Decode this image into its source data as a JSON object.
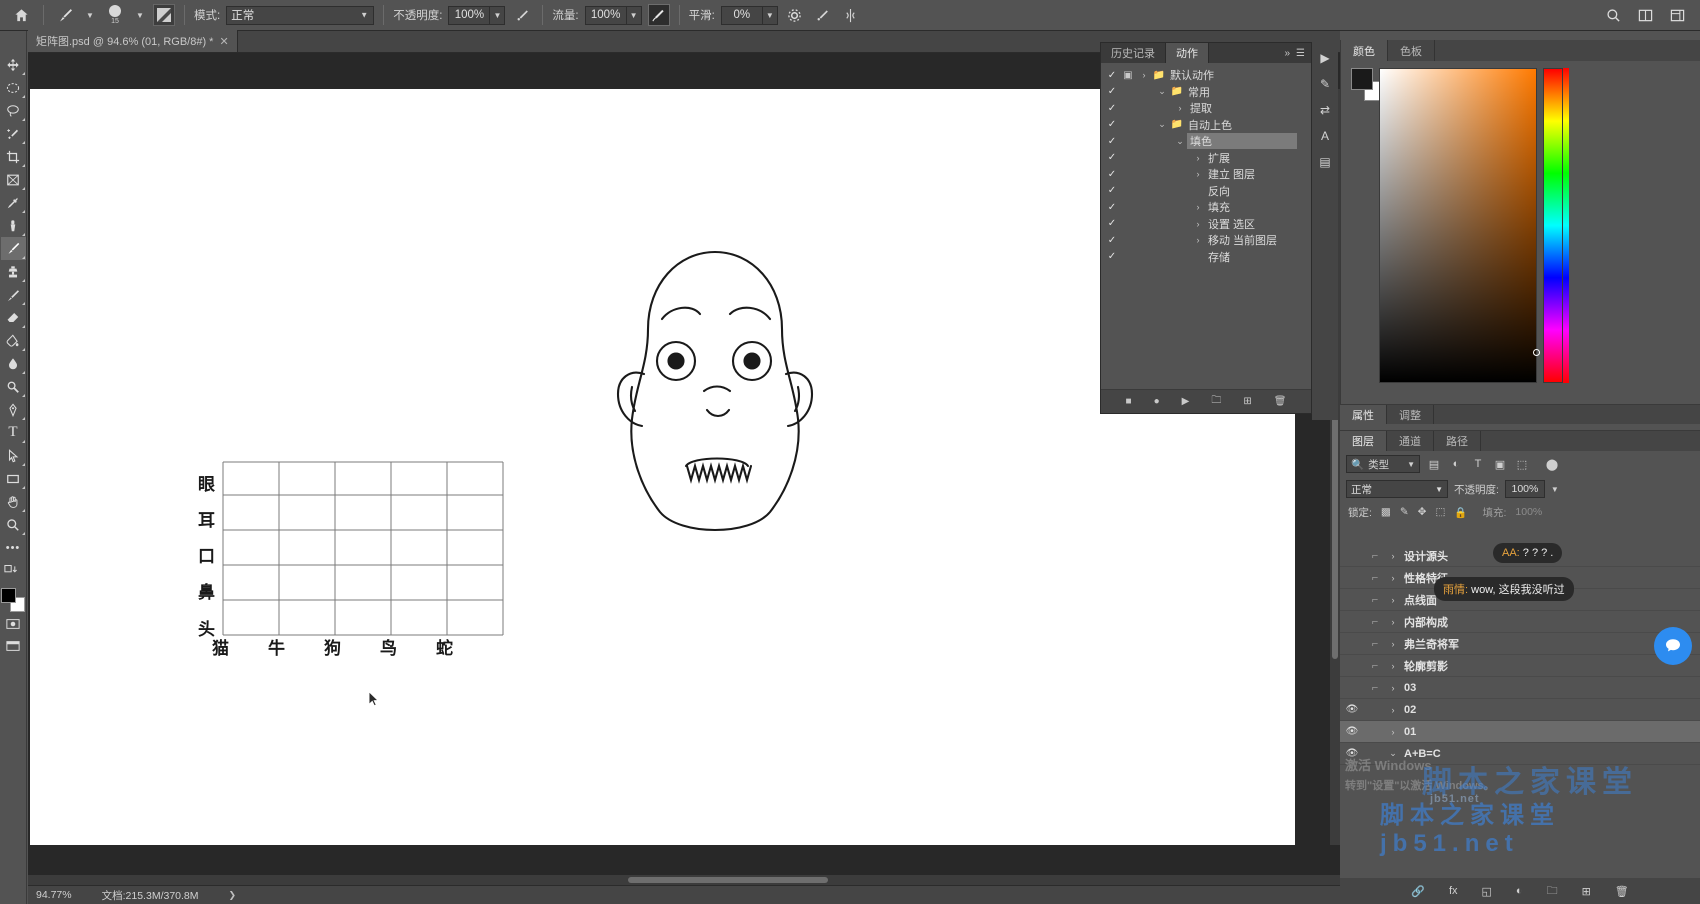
{
  "options_bar": {
    "home_icon": "home-icon",
    "brush_tool_icon": "brush-icon",
    "brush_size": "15",
    "brush_panel_icon": "brush-panel-icon",
    "mode_label": "模式:",
    "mode_value": "正常",
    "opacity_label": "不透明度:",
    "opacity_value": "100%",
    "pressure_opacity_icon": "pressure-opacity-icon",
    "flow_label": "流量:",
    "flow_value": "100%",
    "airbrush_icon": "airbrush-icon",
    "smoothing_label": "平滑:",
    "smoothing_value": "0%",
    "gear_icon": "gear-icon",
    "pressure_size_icon": "pressure-size-icon",
    "symmetry_icon": "symmetry-icon",
    "search_icon": "search-icon",
    "arrange_icon": "arrange-documents-icon",
    "workspace_icon": "workspace-switcher-icon"
  },
  "document_tab": {
    "title": "矩阵图.psd @ 94.6% (01, RGB/8#) *",
    "close_icon": "close-icon"
  },
  "toolbar": {
    "tools": [
      {
        "name": "move-tool",
        "icon": "✥"
      },
      {
        "name": "elliptical-marquee-tool",
        "icon": "◯"
      },
      {
        "name": "lasso-tool",
        "icon": "◝"
      },
      {
        "name": "quick-selection-tool",
        "icon": "✧"
      },
      {
        "name": "crop-tool",
        "icon": "⌗"
      },
      {
        "name": "frame-tool",
        "icon": "⊠"
      },
      {
        "name": "eyedropper-tool",
        "icon": "⚲"
      },
      {
        "name": "healing-brush-tool",
        "icon": "✎"
      },
      {
        "name": "brush-tool",
        "icon": "✏",
        "selected": true
      },
      {
        "name": "clone-stamp-tool",
        "icon": "⚑"
      },
      {
        "name": "history-brush-tool",
        "icon": "✒"
      },
      {
        "name": "eraser-tool",
        "icon": "◓"
      },
      {
        "name": "gradient-tool",
        "icon": "◧"
      },
      {
        "name": "blur-tool",
        "icon": "💧"
      },
      {
        "name": "dodge-tool",
        "icon": "◉"
      },
      {
        "name": "pen-tool",
        "icon": "✒"
      },
      {
        "name": "type-tool",
        "icon": "T"
      },
      {
        "name": "path-selection-tool",
        "icon": "➤"
      },
      {
        "name": "rectangle-tool",
        "icon": "▭"
      },
      {
        "name": "hand-tool",
        "icon": "✋"
      },
      {
        "name": "zoom-tool",
        "icon": "🔍"
      },
      {
        "name": "more-tools",
        "icon": "•••"
      }
    ],
    "edit_toolbar_icon": "edit-toolbar-icon",
    "foreground_color": "#000000",
    "background_color": "#ffffff",
    "quick_mask_icon": "quick-mask-icon",
    "screen_mode_icon": "screen-mode-icon"
  },
  "canvas": {
    "matrix": {
      "row_labels": [
        "眼",
        "耳",
        "口",
        "鼻",
        "头"
      ],
      "col_labels": [
        "猫",
        "牛",
        "狗",
        "鸟",
        "蛇"
      ],
      "rows": 5,
      "cols": 5
    },
    "artwork_name": "face-line-drawing",
    "cursor_name": "mouse-cursor"
  },
  "actions_panel": {
    "tabs": [
      {
        "label": "历史记录",
        "active": false
      },
      {
        "label": "动作",
        "active": true
      }
    ],
    "collapse_icon": "collapse-icon",
    "menu_icon": "panel-menu-icon",
    "items": [
      {
        "label": "默认动作",
        "checked": true,
        "type": "folder",
        "indent": 0,
        "expand": "›",
        "has_box": true
      },
      {
        "label": "常用",
        "checked": true,
        "type": "folder",
        "indent": 1,
        "expand": "⌄"
      },
      {
        "label": "提取",
        "checked": true,
        "type": "action",
        "indent": 2,
        "expand": "›"
      },
      {
        "label": "自动上色",
        "checked": true,
        "type": "folder",
        "indent": 1,
        "expand": "⌄"
      },
      {
        "label": "填色",
        "checked": true,
        "type": "action",
        "indent": 2,
        "expand": "⌄",
        "selected": true
      },
      {
        "label": "扩展",
        "checked": true,
        "type": "step",
        "indent": 3,
        "expand": "›"
      },
      {
        "label": "建立 图层",
        "checked": true,
        "type": "step",
        "indent": 3,
        "expand": "›"
      },
      {
        "label": "反向",
        "checked": true,
        "type": "step",
        "indent": 3,
        "expand": ""
      },
      {
        "label": "填充",
        "checked": true,
        "type": "step",
        "indent": 3,
        "expand": "›"
      },
      {
        "label": "设置 选区",
        "checked": true,
        "type": "step",
        "indent": 3,
        "expand": "›"
      },
      {
        "label": "移动 当前图层",
        "checked": true,
        "type": "step",
        "indent": 3,
        "expand": "›"
      },
      {
        "label": "存储",
        "checked": true,
        "type": "step",
        "indent": 3,
        "expand": ""
      }
    ],
    "footer_icons": [
      "stop-icon",
      "record-icon",
      "play-icon",
      "new-set-icon",
      "new-action-icon",
      "delete-icon"
    ]
  },
  "dock_rail": {
    "buttons": [
      "play-rail-icon",
      "brush-rail-icon",
      "adjust-rail-icon",
      "text-rail-icon",
      "layers-rail-icon"
    ]
  },
  "color_panel": {
    "tabs": [
      {
        "label": "颜色",
        "active": true
      },
      {
        "label": "色板",
        "active": false
      }
    ],
    "foreground_color": "#1a1a1a",
    "background_color": "#ffffff",
    "picker_name": "color-field-picker",
    "hue_slider_name": "hue-slider"
  },
  "properties_tabs": [
    {
      "label": "属性",
      "active": true
    },
    {
      "label": "调整",
      "active": false
    }
  ],
  "layers_panel": {
    "tabs": [
      {
        "label": "图层",
        "active": true
      },
      {
        "label": "通道",
        "active": false
      },
      {
        "label": "路径",
        "active": false
      }
    ],
    "filter_label": "类型",
    "filter_icons": [
      "pixel-filter-icon",
      "adjustment-filter-icon",
      "type-filter-icon",
      "shape-filter-icon",
      "smart-object-filter-icon",
      "filter-toggle-icon"
    ],
    "blend_mode": "正常",
    "opacity_label": "不透明度:",
    "opacity_value": "100%",
    "lock_label": "锁定:",
    "fill_label": "填充:",
    "fill_value": "100%",
    "lock_icons": [
      "lock-transparent-icon",
      "lock-image-icon",
      "lock-position-icon",
      "lock-artboard-icon",
      "lock-all-icon"
    ],
    "layers": [
      {
        "name": "设计源头",
        "visible": false,
        "expand": "›",
        "selected": false
      },
      {
        "name": "性格特征",
        "visible": false,
        "expand": "›",
        "selected": false
      },
      {
        "name": "点线面",
        "visible": false,
        "expand": "›",
        "selected": false
      },
      {
        "name": "内部构成",
        "visible": false,
        "expand": "›",
        "selected": false
      },
      {
        "name": "弗兰奇将军",
        "visible": false,
        "expand": "›",
        "selected": false
      },
      {
        "name": "轮廓剪影",
        "visible": false,
        "expand": "›",
        "selected": false
      },
      {
        "name": "03",
        "visible": false,
        "expand": "›",
        "selected": false
      },
      {
        "name": "02",
        "visible": true,
        "expand": "›",
        "selected": false
      },
      {
        "name": "01",
        "visible": true,
        "expand": "›",
        "selected": true
      },
      {
        "name": "A+B=C",
        "visible": true,
        "expand": "⌄",
        "selected": false
      }
    ],
    "footer_icons": [
      "link-layers-icon",
      "layer-style-icon",
      "layer-mask-icon",
      "adjustment-layer-icon",
      "new-group-icon",
      "new-layer-icon",
      "delete-layer-icon"
    ]
  },
  "chat_overlay": {
    "bubbles": [
      {
        "sender": "AA:",
        "text": " ? ? ? ."
      },
      {
        "sender": "雨情:",
        "text": " wow, 这段我没听过"
      }
    ],
    "fab_icon": "chat-bubble-icon"
  },
  "watermarks": {
    "main": "脚本之家课堂",
    "sub": "jb51.net",
    "gray_left": "激活 Windows",
    "gray_left2": "转到\"设置\"以激活 Windows。",
    "gray_right": "脚本之家课堂 jb51.net"
  },
  "status_bar": {
    "zoom": "94.77%",
    "doc_label": "文档:215.3M/370.8M",
    "caret_icon": "status-caret-icon"
  }
}
